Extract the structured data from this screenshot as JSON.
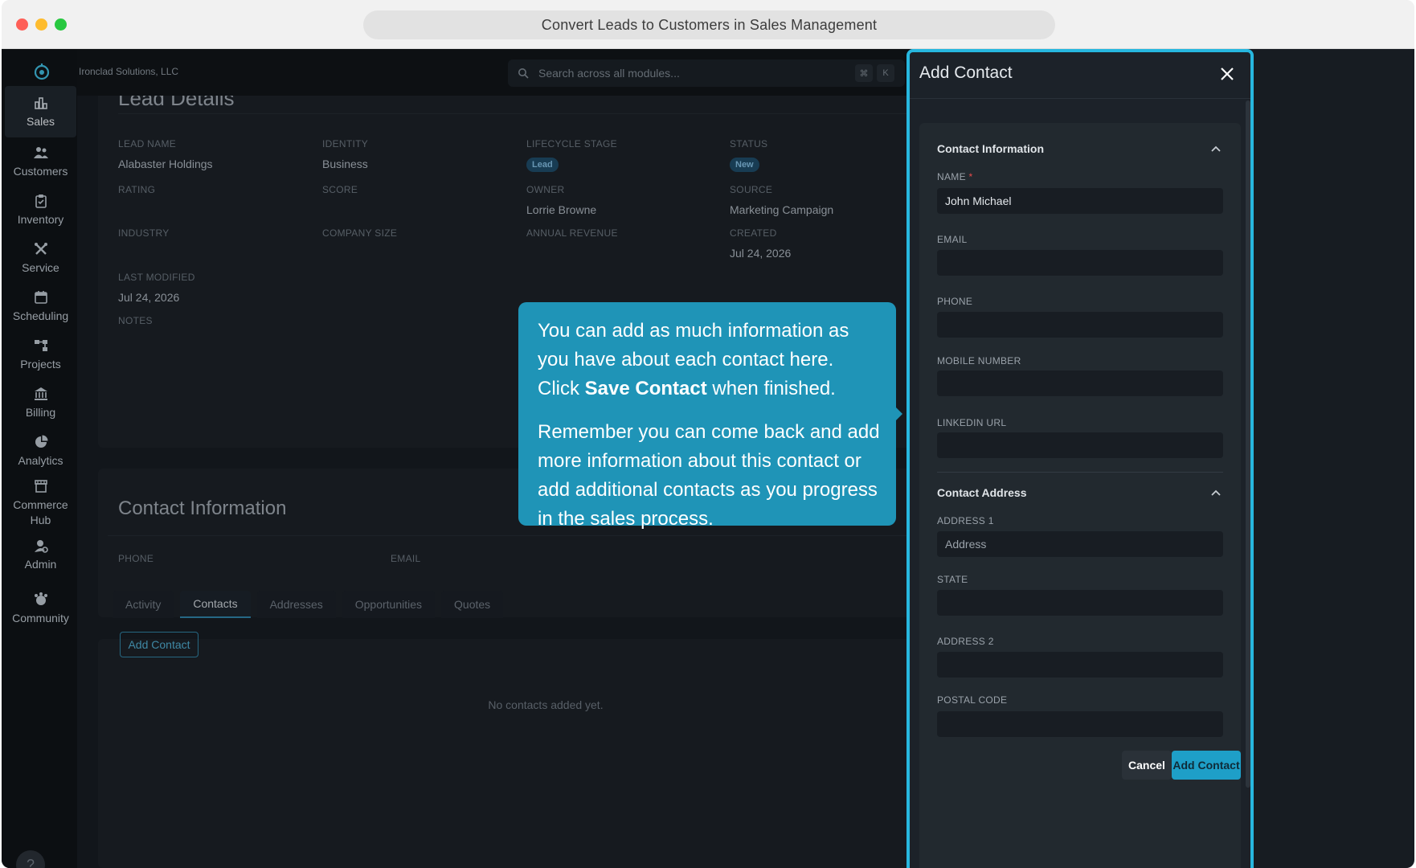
{
  "window": {
    "title": "Convert Leads to Customers in Sales Management"
  },
  "header": {
    "company": "Ironclad Solutions, LLC",
    "search_placeholder": "Search across all modules...",
    "kbd_cmd": "⌘",
    "kbd_k": "K"
  },
  "sidebar": {
    "items": [
      {
        "label": "Sales",
        "icon": "bar-chart-icon",
        "active": true
      },
      {
        "label": "Customers",
        "icon": "users-icon"
      },
      {
        "label": "Inventory",
        "icon": "clipboard-icon"
      },
      {
        "label": "Service",
        "icon": "tools-icon"
      },
      {
        "label": "Scheduling",
        "icon": "calendar-icon"
      },
      {
        "label": "Projects",
        "icon": "hierarchy-icon"
      },
      {
        "label": "Billing",
        "icon": "bank-icon"
      },
      {
        "label": "Analytics",
        "icon": "pie-chart-icon"
      },
      {
        "label": "Commerce Hub",
        "icon": "store-icon"
      },
      {
        "label": "Admin",
        "icon": "user-gear-icon"
      },
      {
        "label": "Community",
        "icon": "community-icon"
      }
    ],
    "help": "?"
  },
  "lead": {
    "title": "Lead Details",
    "fields": {
      "lead_name_label": "LEAD NAME",
      "lead_name": "Alabaster Holdings",
      "identity_label": "IDENTITY",
      "identity": "Business",
      "lifecycle_label": "LIFECYCLE STAGE",
      "lifecycle": "Lead",
      "status_label": "STATUS",
      "status": "New",
      "rating_label": "RATING",
      "score_label": "SCORE",
      "owner_label": "OWNER",
      "owner": "Lorrie Browne",
      "source_label": "SOURCE",
      "source": "Marketing Campaign",
      "industry_label": "INDUSTRY",
      "company_size_label": "COMPANY SIZE",
      "annual_revenue_label": "ANNUAL REVENUE",
      "created_label": "CREATED",
      "created": "Jul 24, 2026",
      "last_modified_label": "LAST MODIFIED",
      "last_modified": "Jul 24, 2026",
      "notes_label": "NOTES"
    }
  },
  "contact_info": {
    "title": "Contact Information",
    "phone_label": "PHONE",
    "email_label": "EMAIL"
  },
  "tabs": [
    "Activity",
    "Contacts",
    "Addresses",
    "Opportunities",
    "Quotes"
  ],
  "contacts_tab": {
    "add_button": "Add Contact",
    "empty_text": "No contacts added yet."
  },
  "callout": {
    "p1_a": "You can add as much information as you have about each contact here. Click ",
    "p1_bold": "Save Contact",
    "p1_b": " when finished.",
    "p2": "Remember you can come back and add more information about this contact or add additional contacts as you progress in the sales process."
  },
  "panel": {
    "title": "Add Contact",
    "section_contact": "Contact Information",
    "name_label": "NAME",
    "required_mark": "*",
    "name_value": "John Michael",
    "email_label": "EMAIL",
    "phone_label": "PHONE",
    "mobile_label": "MOBILE NUMBER",
    "linkedin_label": "LINKEDIN URL",
    "section_address": "Contact Address",
    "address1_label": "ADDRESS 1",
    "address1_placeholder": "Address",
    "state_label": "STATE",
    "address2_label": "ADDRESS 2",
    "postal_label": "POSTAL CODE",
    "cancel": "Cancel",
    "submit": "Add Contact"
  }
}
